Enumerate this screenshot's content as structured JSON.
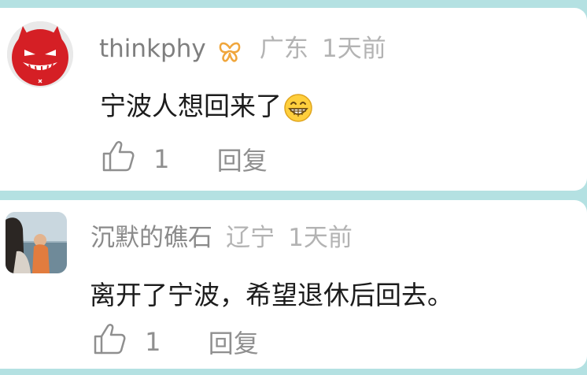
{
  "comments": [
    {
      "username": "thinkphy",
      "badge_icon": "butterfly-badge-icon",
      "location": "广东",
      "time": "1天前",
      "content": "宁波人想回来了",
      "emoji": "grinning-face-emoji",
      "likes": "1",
      "reply_label": "回复",
      "avatar": "red-devil-avatar"
    },
    {
      "username": "沉默的礁石",
      "location": "辽宁",
      "time": "1天前",
      "content": "离开了宁波，希望退休后回去。",
      "likes": "1",
      "reply_label": "回复",
      "avatar": "seaside-photo-avatar"
    }
  ],
  "colors": {
    "page_background": "#b4e1e2",
    "card_background": "#ffffff",
    "username": "#8a8a8a",
    "meta": "#b3b3b3",
    "content": "#1c1c1c",
    "badge": "#f0a63c"
  }
}
